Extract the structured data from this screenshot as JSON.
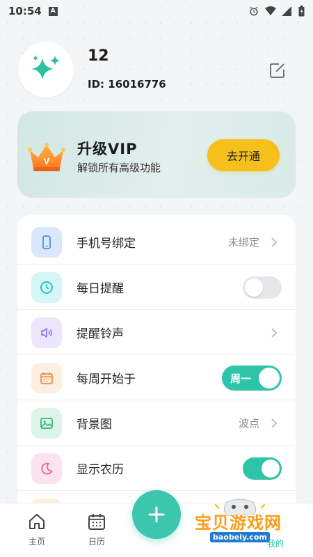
{
  "status_bar": {
    "time": "10:54",
    "notification_letter": "A"
  },
  "profile": {
    "username": "12",
    "user_id": "ID: 16016776"
  },
  "vip": {
    "title": "升级VIP",
    "subtitle": "解锁所有高级功能",
    "button": "去开通",
    "crown_letter": "V"
  },
  "settings": [
    {
      "label": "手机号绑定",
      "value": "未绑定",
      "icon": "phone-icon",
      "control": "chevron"
    },
    {
      "label": "每日提醒",
      "icon": "clock-icon",
      "control": "toggle",
      "on": false
    },
    {
      "label": "提醒铃声",
      "icon": "speaker-icon",
      "control": "chevron"
    },
    {
      "label": "每周开始于",
      "icon": "calendar-icon",
      "control": "toggle-label",
      "toggle_label": "周一",
      "on": true
    },
    {
      "label": "背景图",
      "value": "波点",
      "icon": "image-icon",
      "control": "chevron"
    },
    {
      "label": "显示农历",
      "icon": "moon-icon",
      "control": "toggle",
      "on": true
    }
  ],
  "bottom_nav": {
    "home": "主页",
    "calendar": "日历"
  },
  "watermark": {
    "text": "宝贝游戏网",
    "url": "baobeiy.com",
    "mine": "我的"
  },
  "colors": {
    "accent": "#2ec4a8",
    "vip_button": "#f6c01c",
    "text": "#222222",
    "muted": "#8a8d93"
  }
}
